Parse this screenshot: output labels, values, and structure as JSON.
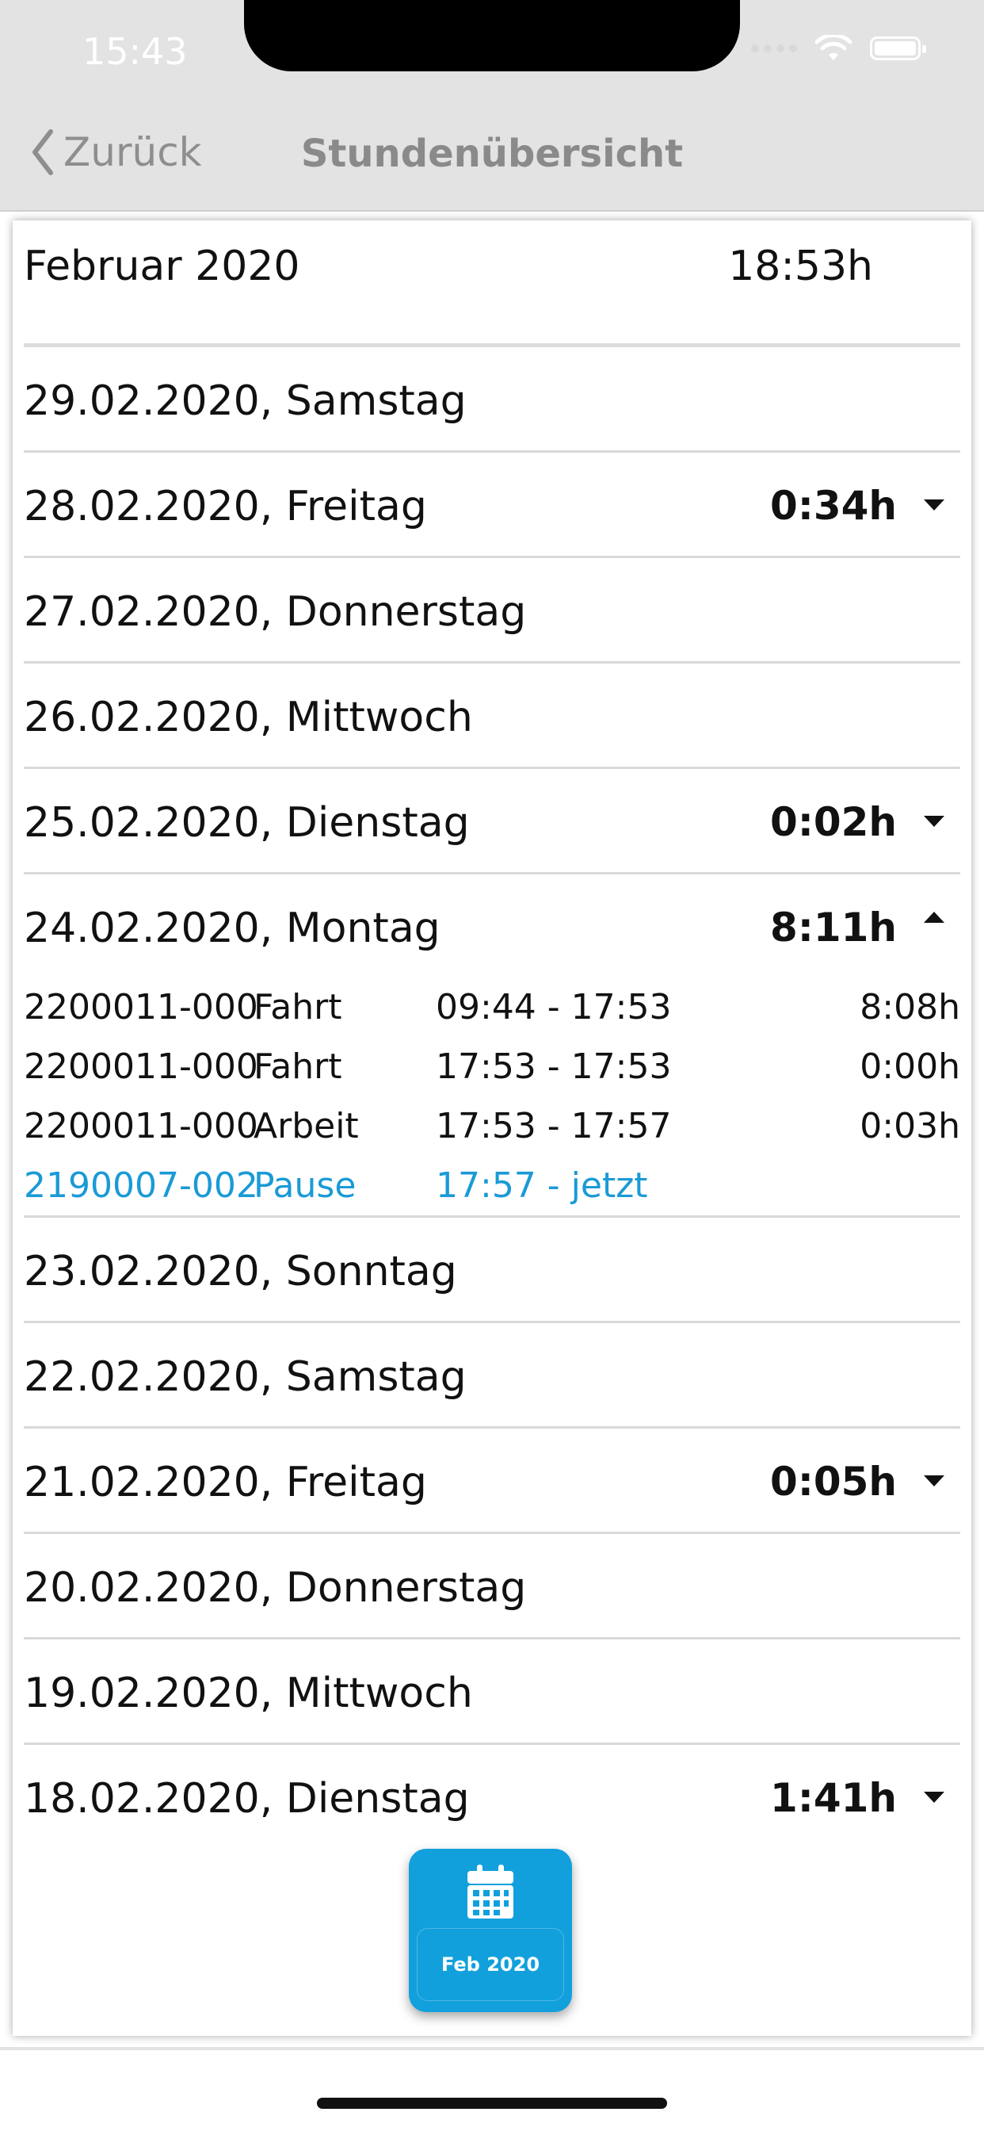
{
  "status_bar": {
    "time": "15:43"
  },
  "nav": {
    "back_label": "Zurück",
    "title": "Stundenübersicht"
  },
  "month": {
    "label": "Februar 2020",
    "total": "18:53h"
  },
  "days": [
    {
      "label": "29.02.2020, Samstag",
      "hours": "",
      "caret": ""
    },
    {
      "label": "28.02.2020, Freitag",
      "hours": "0:34h",
      "caret": "down"
    },
    {
      "label": "27.02.2020, Donnerstag",
      "hours": "",
      "caret": ""
    },
    {
      "label": "26.02.2020, Mittwoch",
      "hours": "",
      "caret": ""
    },
    {
      "label": "25.02.2020, Dienstag",
      "hours": "0:02h",
      "caret": "down"
    },
    {
      "label": "24.02.2020, Montag",
      "hours": "8:11h",
      "caret": "up"
    },
    {
      "label": "23.02.2020, Sonntag",
      "hours": "",
      "caret": ""
    },
    {
      "label": "22.02.2020, Samstag",
      "hours": "",
      "caret": ""
    },
    {
      "label": "21.02.2020, Freitag",
      "hours": "0:05h",
      "caret": "down"
    },
    {
      "label": "20.02.2020, Donnerstag",
      "hours": "",
      "caret": ""
    },
    {
      "label": "19.02.2020, Mittwoch",
      "hours": "",
      "caret": ""
    },
    {
      "label": "18.02.2020, Dienstag",
      "hours": "1:41h",
      "caret": "down"
    }
  ],
  "entries": [
    {
      "project": "2200011-000",
      "type": "Fahrt",
      "time": "09:44 - 17:53",
      "duration": "8:08h",
      "active": false
    },
    {
      "project": "2200011-000",
      "type": "Fahrt",
      "time": "17:53 - 17:53",
      "duration": "0:00h",
      "active": false
    },
    {
      "project": "2200011-000",
      "type": "Arbeit",
      "time": "17:53 - 17:57",
      "duration": "0:03h",
      "active": false
    },
    {
      "project": "2190007-002",
      "type": "Pause",
      "time": "17:57 - jetzt",
      "duration": "",
      "active": true
    }
  ],
  "fab": {
    "label": "Feb 2020",
    "icon": "calendar-icon"
  },
  "colors": {
    "accent": "#12a0dd",
    "active_text": "#1a9ad6",
    "topbar": "#e3e3e3"
  }
}
